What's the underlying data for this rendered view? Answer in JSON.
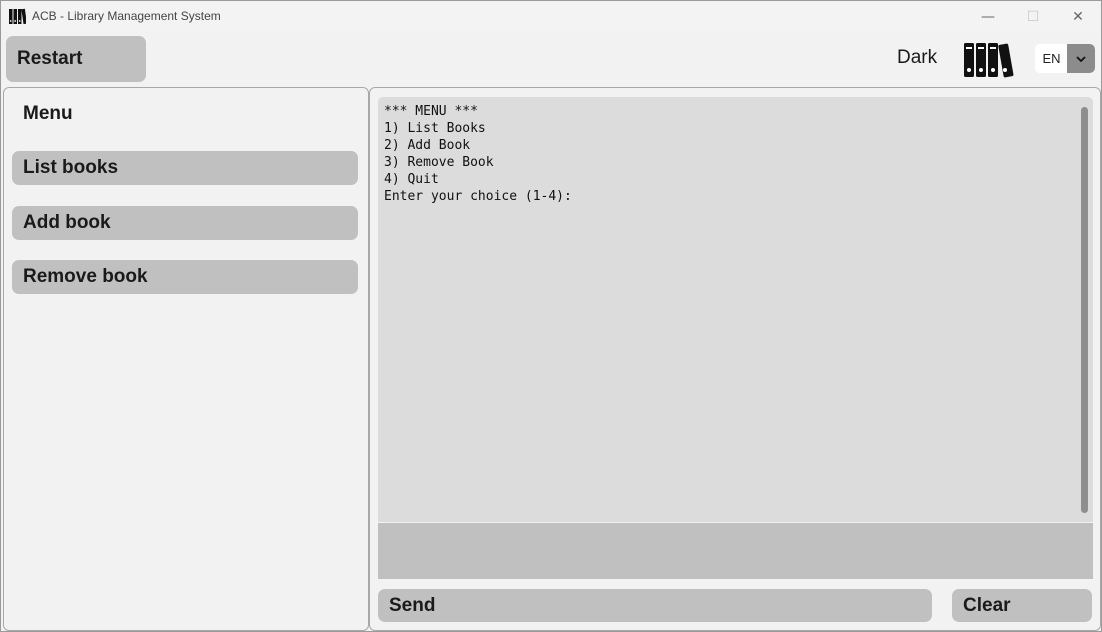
{
  "window": {
    "title": "ACB - Library Management System",
    "minimize_glyph": "—",
    "maximize_glyph": "☐",
    "close_glyph": "✕"
  },
  "toolbar": {
    "restart_label": "Restart",
    "theme_label": "Dark",
    "logo_icon": "bookshelf-icon",
    "language": {
      "selected": "EN",
      "arrow_icon": "chevron-down-icon"
    }
  },
  "sidebar": {
    "title": "Menu",
    "items": [
      {
        "label": "List books"
      },
      {
        "label": "Add book"
      },
      {
        "label": "Remove book"
      }
    ]
  },
  "console": {
    "output": "*** MENU ***\n1) List Books\n2) Add Book\n3) Remove Book\n4) Quit\nEnter your choice (1-4):",
    "input_value": ""
  },
  "actions": {
    "send_label": "Send",
    "clear_label": "Clear"
  },
  "colors": {
    "window_bg": "#f2f2f2",
    "button_bg": "#c0c0c0",
    "console_bg": "#dcdcdc",
    "text": "#1a1a1a"
  }
}
